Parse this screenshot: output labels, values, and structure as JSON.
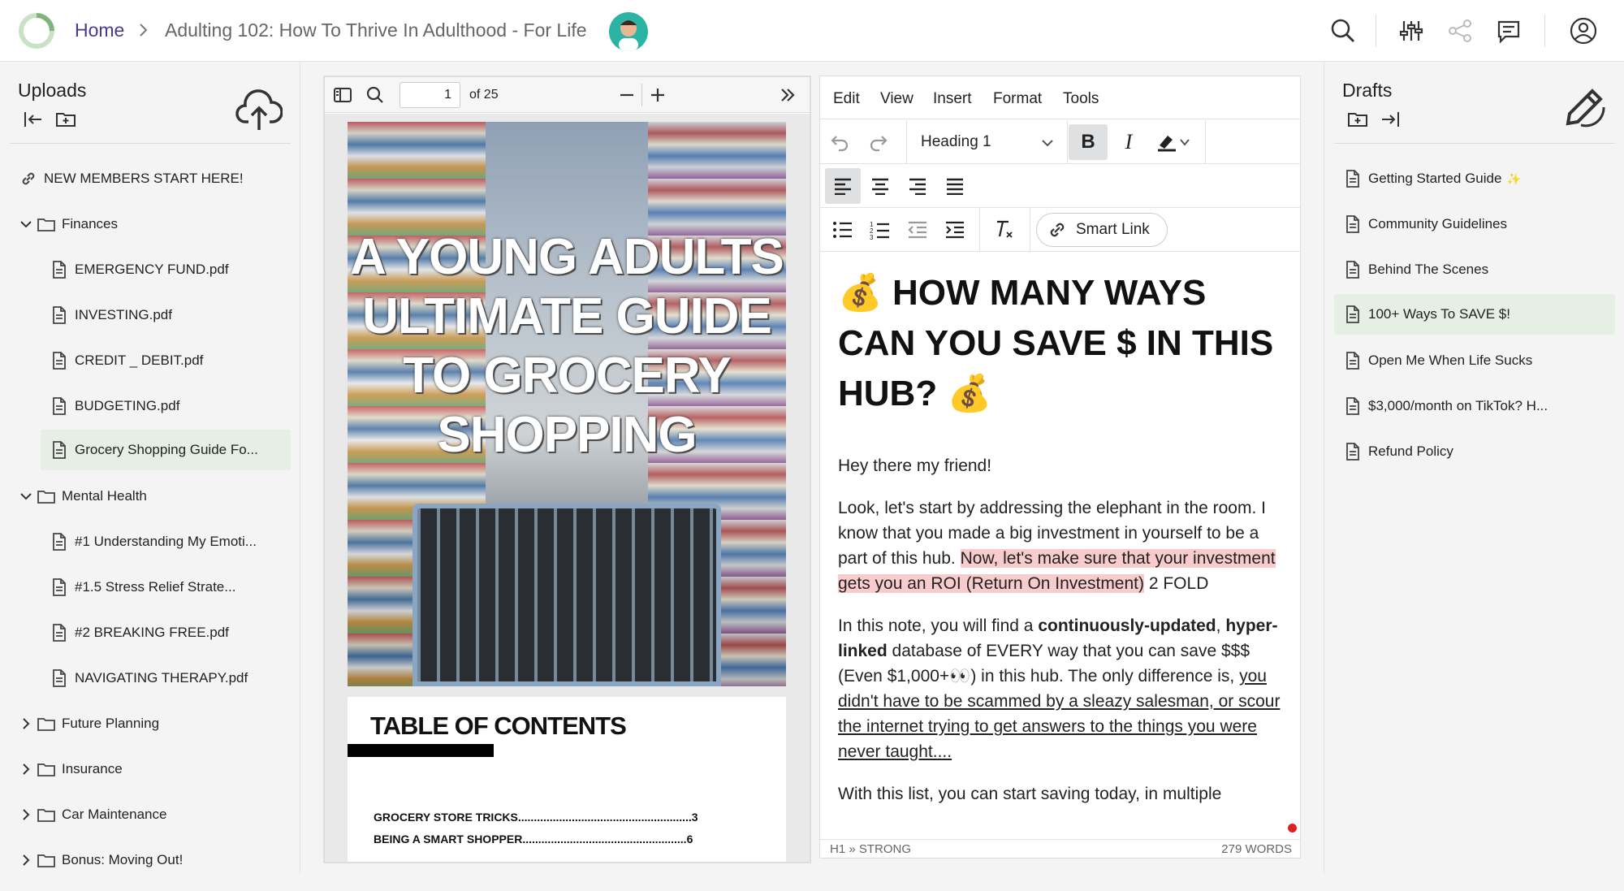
{
  "header": {
    "home_label": "Home",
    "title": "Adulting 102: How To Thrive In Adulthood - For Life",
    "icons": [
      "search-icon",
      "sliders-icon",
      "share-icon",
      "chat-icon",
      "user-icon"
    ]
  },
  "uploads": {
    "title": "Uploads",
    "items": [
      {
        "label": "NEW MEMBERS START HERE!",
        "type": "link"
      },
      {
        "label": "Finances",
        "type": "folder",
        "expanded": true
      },
      {
        "label": "EMERGENCY FUND.pdf",
        "type": "file"
      },
      {
        "label": "INVESTING.pdf",
        "type": "file"
      },
      {
        "label": "CREDIT _ DEBIT.pdf",
        "type": "file"
      },
      {
        "label": "BUDGETING.pdf",
        "type": "file"
      },
      {
        "label": "Grocery Shopping Guide Fo...",
        "type": "file",
        "selected": true
      },
      {
        "label": "Mental Health",
        "type": "folder",
        "expanded": true
      },
      {
        "label": "#1 Understanding My Emoti...",
        "type": "file"
      },
      {
        "label": "#1.5 Stress Relief Strate...",
        "type": "file"
      },
      {
        "label": "#2 BREAKING FREE.pdf",
        "type": "file"
      },
      {
        "label": "NAVIGATING THERAPY.pdf",
        "type": "file"
      },
      {
        "label": "Future Planning",
        "type": "folder",
        "expanded": false
      },
      {
        "label": "Insurance",
        "type": "folder",
        "expanded": false
      },
      {
        "label": "Car Maintenance",
        "type": "folder",
        "expanded": false
      },
      {
        "label": "Bonus: Moving Out!",
        "type": "folder",
        "expanded": false
      }
    ]
  },
  "viewer": {
    "page_value": "1",
    "page_of": "of 25",
    "cover_title": "A YOUNG ADULTS ULTIMATE GUIDE TO GROCERY SHOPPING",
    "toc_title": "TABLE OF CONTENTS",
    "toc_lines": [
      "GROCERY STORE TRICKS.......................................................3",
      "BEING A SMART SHOPPER....................................................6"
    ]
  },
  "editor": {
    "menu": [
      "Edit",
      "View",
      "Insert",
      "Format",
      "Tools"
    ],
    "block_format": "Heading 1",
    "smart_link_label": "Smart Link",
    "heading_emoji": "💰",
    "heading": "HOW MANY WAYS CAN YOU SAVE $ IN THIS HUB?",
    "p1": "Hey there my friend!",
    "p2_a": "Look, let's start by addressing the elephant in the room. I know that you made a big investment in yourself to be a part of this hub. ",
    "p2_hl": "Now, let's make sure that your investment gets you an ROI (Return On Investment)",
    "p2_b": " 2 FOLD",
    "p3_a": "In this note, you will find a ",
    "p3_b1": "continuously-updated",
    "p3_c": ", ",
    "p3_b2": "hyper-linked",
    "p3_d": " database of EVERY way that you can save $$$ (Even $1,000+👀) in this hub. The only difference is, ",
    "p3_u": "you didn't have to be scammed by a sleazy salesman, or scour the internet trying to get answers to the things you were never taught....",
    "p4": "With this list, you can start saving today, in multiple",
    "status_path": "H1 » STRONG",
    "status_words": "279 WORDS"
  },
  "drafts": {
    "title": "Drafts",
    "items": [
      {
        "label": "Getting Started Guide",
        "suffix": "✨"
      },
      {
        "label": "Community Guidelines"
      },
      {
        "label": "Behind The Scenes"
      },
      {
        "label": "100+ Ways To SAVE $!",
        "selected": true
      },
      {
        "label": "Open Me When Life Sucks"
      },
      {
        "label": "$3,000/month on TikTok? H..."
      },
      {
        "label": "Refund Policy"
      }
    ]
  }
}
